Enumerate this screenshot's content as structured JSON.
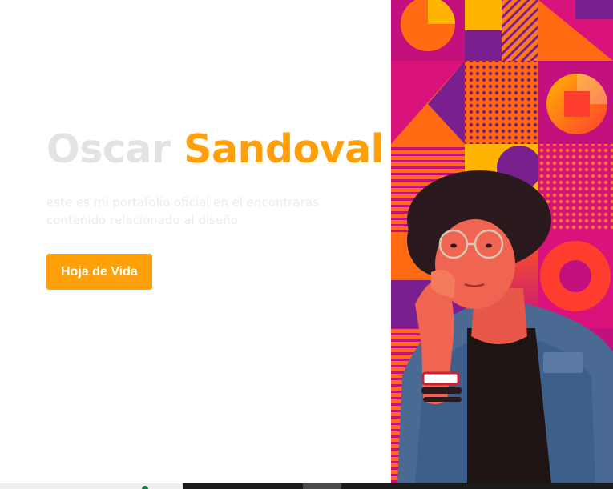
{
  "hero": {
    "first_name": "Oscar",
    "last_name": "Sandoval",
    "description": "este es mi portafolio oficial en el encontraras contenido relacionado al diseño",
    "button_label": "Hoja de Vida"
  },
  "colors": {
    "accent": "#ff9f0a",
    "first_name": "#e3e3e3",
    "description": "#ececec",
    "magenta": "#c2117e",
    "orange": "#ff6a13",
    "purple": "#7a1f8f",
    "yellow": "#ffb400"
  },
  "images": {
    "portrait": "person-portrait-with-glasses",
    "background": "geometric-pattern-mosaic"
  }
}
